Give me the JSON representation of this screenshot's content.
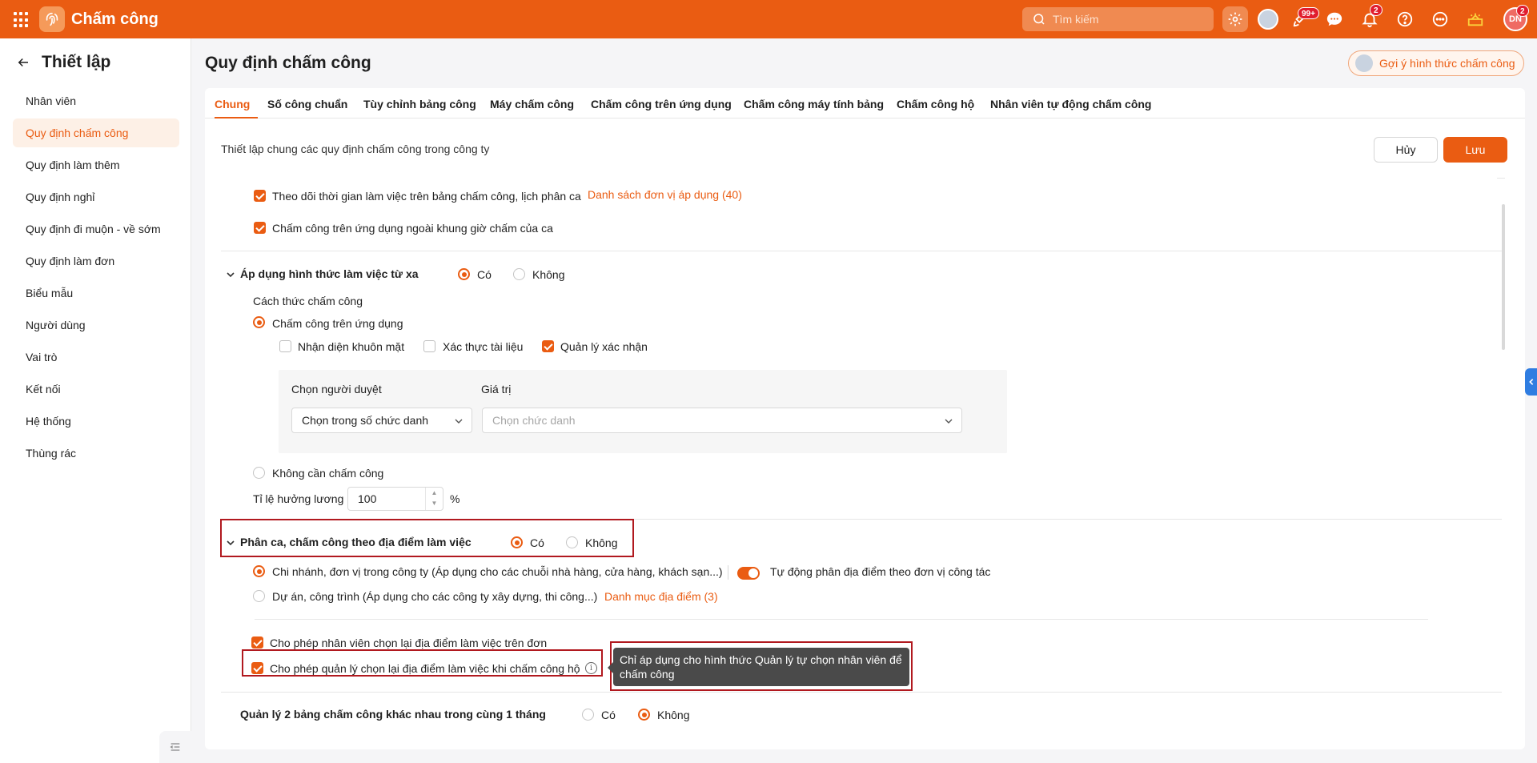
{
  "app": {
    "title": "Chấm công"
  },
  "topbar": {
    "search_placeholder": "Tìm kiếm",
    "badge_rocket": "99+",
    "badge_bell": "2",
    "badge_avatar": "2",
    "user_initials": "DN",
    "accent": "#ea5c12"
  },
  "sidebar": {
    "title": "Thiết lập",
    "items": [
      {
        "label": "Nhân viên"
      },
      {
        "label": "Quy định chấm công"
      },
      {
        "label": "Quy định làm thêm"
      },
      {
        "label": "Quy định nghỉ"
      },
      {
        "label": "Quy định đi muộn - về sớm"
      },
      {
        "label": "Quy định làm đơn"
      },
      {
        "label": "Biểu mẫu"
      },
      {
        "label": "Người dùng"
      },
      {
        "label": "Vai trò"
      },
      {
        "label": "Kết nối"
      },
      {
        "label": "Hệ thống"
      },
      {
        "label": "Thùng rác"
      }
    ]
  },
  "page": {
    "title": "Quy định chấm công",
    "suggest_button": "Gợi ý hình thức chấm công",
    "tabs": [
      {
        "label": "Chung"
      },
      {
        "label": "Số công chuẩn"
      },
      {
        "label": "Tùy chỉnh bảng công"
      },
      {
        "label": "Máy chấm công"
      },
      {
        "label": "Chấm công trên ứng dụng"
      },
      {
        "label": "Chấm công máy tính bảng"
      },
      {
        "label": "Chấm công hộ"
      },
      {
        "label": "Nhân viên tự động chấm công"
      }
    ],
    "description": "Thiết lập chung các quy định chấm công trong công ty",
    "cancel_label": "Hủy",
    "save_label": "Lưu"
  },
  "settings": {
    "track_time": "Theo dõi thời gian làm việc trên bảng chấm công, lịch phân ca",
    "track_time_link": "Danh sách đơn vị áp dụng (40)",
    "outside_shift": "Chấm công trên ứng dụng ngoài khung giờ chấm của ca",
    "remote": {
      "label": "Áp dụng hình thức làm việc từ xa",
      "yes": "Có",
      "no": "Không",
      "method_label": "Cách thức chấm công",
      "app_option": "Chấm công trên ứng dụng",
      "face": "Nhận diện khuôn mặt",
      "document": "Xác thực tài liệu",
      "manager_confirm": "Quản lý xác nhận",
      "approver_label": "Chọn người duyệt",
      "value_label": "Giá trị",
      "approver_value": "Chọn trong số chức danh",
      "value_placeholder": "Chọn chức danh",
      "no_checkin": "Không cần chấm công",
      "salary_ratio_label": "Tỉ lệ hưởng lương",
      "salary_ratio_value": "100",
      "percent": "%"
    },
    "location": {
      "label": "Phân ca, chấm công theo địa điểm làm việc",
      "yes": "Có",
      "no": "Không",
      "branch_option": "Chi nhánh, đơn vị trong công ty (Áp dụng cho các chuỗi nhà hàng, cửa hàng, khách sạn...)",
      "auto_assign": "Tự động phân địa điểm theo đơn vị công tác",
      "project_option": "Dự án, công trình (Áp dụng cho các công ty xây dựng, thi công...)",
      "project_link": "Danh mục địa điểm (3)",
      "employee_choose": "Cho phép nhân viên chọn lại địa điểm làm việc trên đơn",
      "manager_choose": "Cho phép quản lý chọn lại địa điểm làm việc khi chấm công hộ",
      "tooltip": "Chỉ áp dụng cho hình thức Quản lý tự chọn nhân viên để chấm công"
    },
    "two_sheets": {
      "label": "Quản lý 2 bảng chấm công khác nhau trong cùng 1 tháng",
      "yes": "Có",
      "no": "Không"
    }
  }
}
